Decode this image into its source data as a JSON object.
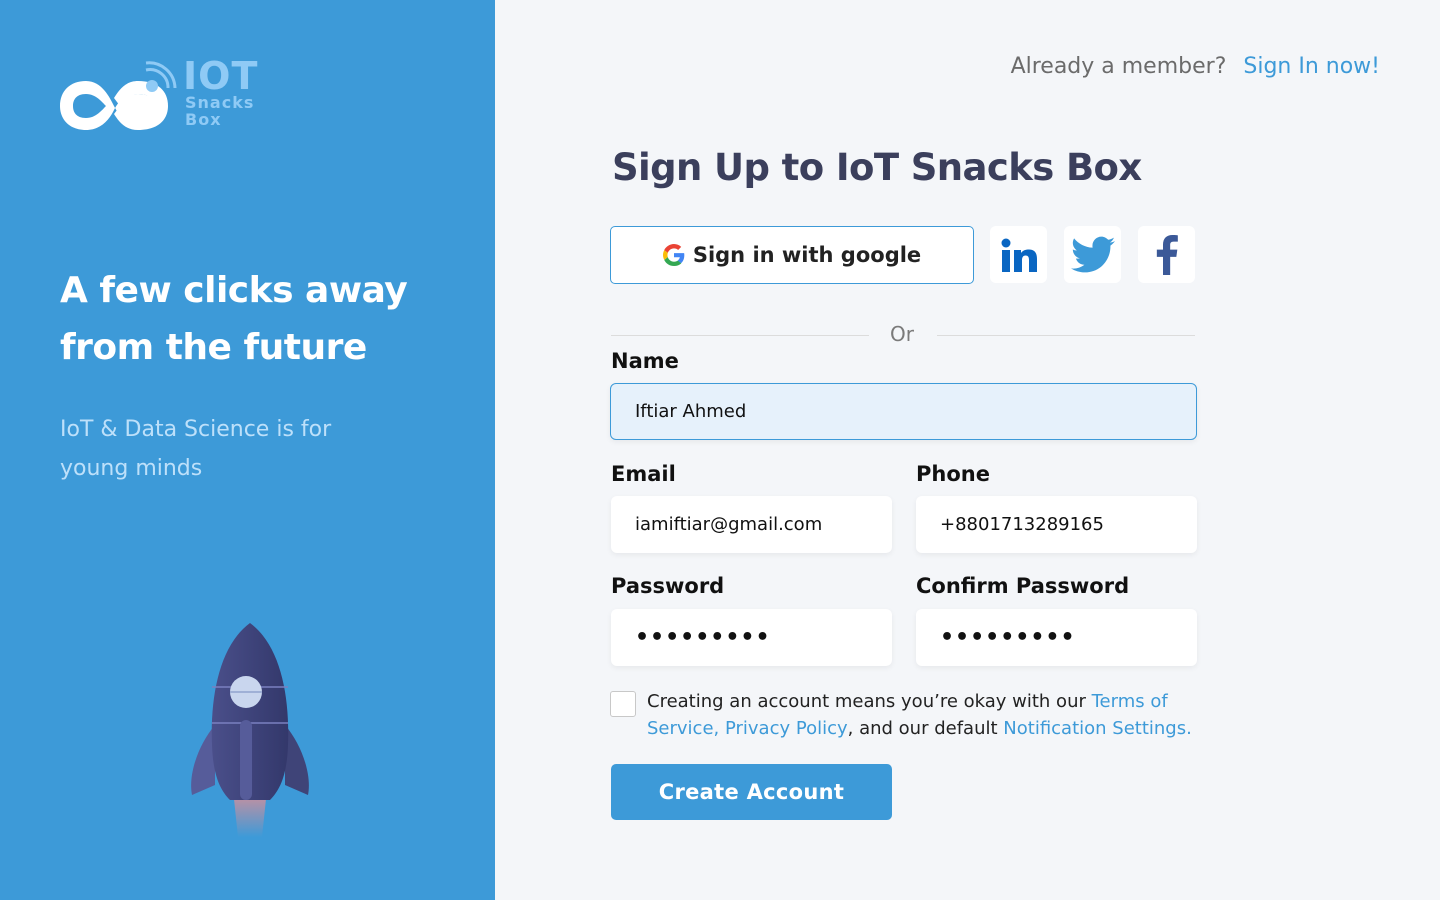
{
  "brand": {
    "logo_iot": "IOT",
    "logo_snacks": "Snacks",
    "logo_box": "Box",
    "hero_line1": "A few clicks away",
    "hero_line2": "from the future",
    "tagline": "IoT & Data Science is for young minds",
    "accent_color": "#3d9ad8"
  },
  "header": {
    "member_prompt": "Already a member?",
    "signin_link": "Sign In now!"
  },
  "form": {
    "title": "Sign Up to IoT Snacks Box",
    "google_button": "Sign in with google",
    "social_icons": [
      "linkedin-icon",
      "twitter-icon",
      "facebook-icon"
    ],
    "divider": "Or",
    "name_label": "Name",
    "name_value": "Iftiar Ahmed",
    "email_label": "Email",
    "email_value": "iamiftiar@gmail.com",
    "phone_label": "Phone",
    "phone_value": "+8801713289165",
    "password_label": "Password",
    "password_value": "•••••••••",
    "confirm_label": "Confirm Password",
    "confirm_value": "•••••••••",
    "terms_prefix": "Creating an account means you’re okay with our ",
    "terms_link1": "Terms of Service, Privacy Policy",
    "terms_middle": ", and our default ",
    "terms_link2": "Notification Settings.",
    "submit": "Create Account"
  }
}
